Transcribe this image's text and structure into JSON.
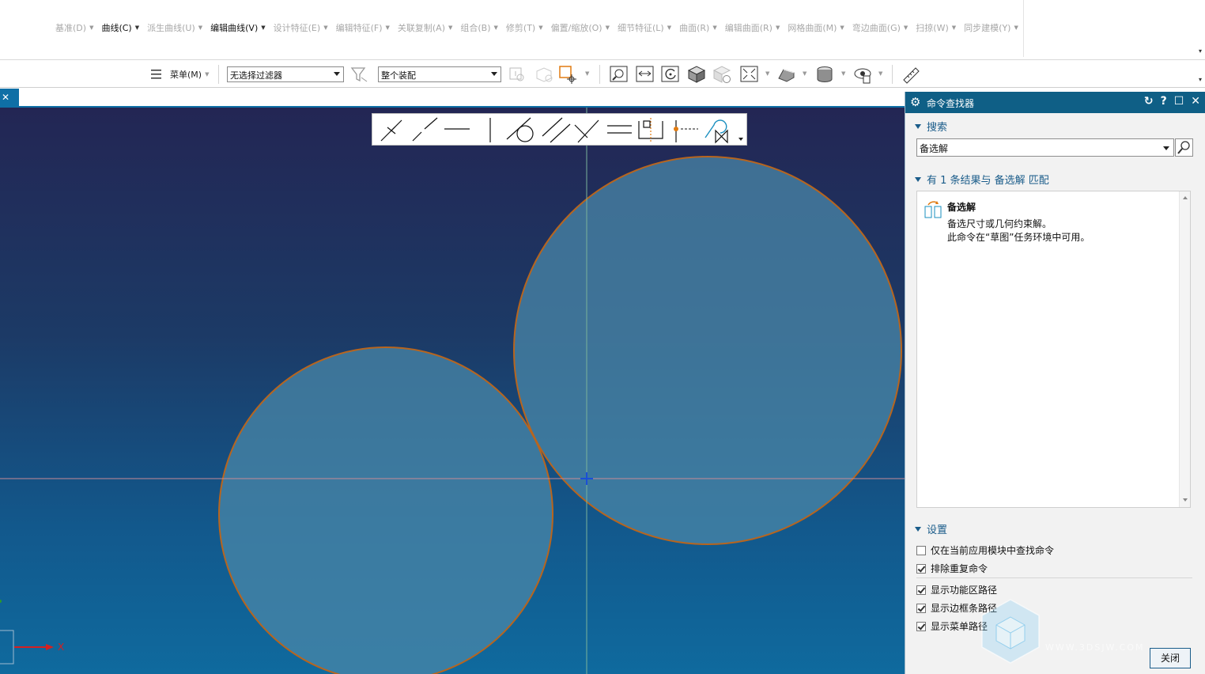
{
  "ribbon": {
    "items": [
      {
        "label": "基准(D)",
        "active": false
      },
      {
        "label": "曲线(C)",
        "active": true
      },
      {
        "label": "派生曲线(U)",
        "active": false
      },
      {
        "label": "编辑曲线(V)",
        "active": true
      },
      {
        "label": "设计特征(E)",
        "active": false
      },
      {
        "label": "编辑特征(F)",
        "active": false
      },
      {
        "label": "关联复制(A)",
        "active": false
      },
      {
        "label": "组合(B)",
        "active": false
      },
      {
        "label": "修剪(T)",
        "active": false
      },
      {
        "label": "偏置/缩放(O)",
        "active": false
      },
      {
        "label": "细节特征(L)",
        "active": false
      },
      {
        "label": "曲面(R)",
        "active": false
      },
      {
        "label": "编辑曲面(R)",
        "active": false
      },
      {
        "label": "网格曲面(M)",
        "active": false
      },
      {
        "label": "弯边曲面(G)",
        "active": false
      },
      {
        "label": "扫掠(W)",
        "active": false
      },
      {
        "label": "同步建模(Y)",
        "active": false
      }
    ]
  },
  "toolbar": {
    "menu_label": "菜单(M)",
    "filter_value": "无选择过滤器",
    "assembly_value": "整个装配"
  },
  "tab": {
    "close_glyph": "✕"
  },
  "viewport": {
    "axis_x_label": "X",
    "colors": {
      "circle_fill": "#4a87a8",
      "circle_stroke": "#b8651e",
      "crosshair": "#1a4fd6"
    }
  },
  "panel": {
    "title": "命令查找器",
    "search_heading": "搜索",
    "search_value": "备选解",
    "results_heading": "有 1 条结果与 备选解 匹配",
    "result": {
      "name": "备选解",
      "description": "备选尺寸或几何约束解。",
      "availability": "此命令在“草图”任务环境中可用。"
    },
    "settings_heading": "设置",
    "settings": [
      {
        "label": "仅在当前应用模块中查找命令",
        "checked": false
      },
      {
        "label": "排除重复命令",
        "checked": true
      },
      {
        "label": "显示功能区路径",
        "checked": true
      },
      {
        "label": "显示边框条路径",
        "checked": true
      },
      {
        "label": "显示菜单路径",
        "checked": true
      }
    ],
    "close_label": "关闭"
  },
  "watermark": {
    "text": "WWW.3DSJW.COM"
  }
}
